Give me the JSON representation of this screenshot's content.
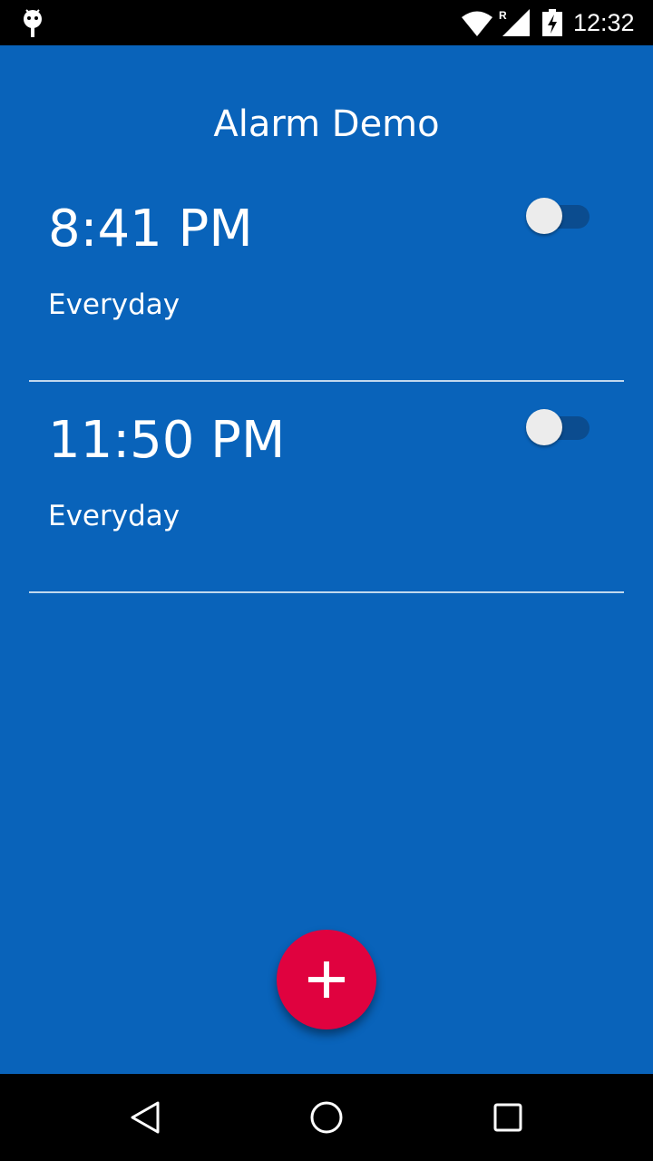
{
  "status_bar": {
    "time": "12:32",
    "icons": [
      "android-debug-icon",
      "wifi-icon",
      "cell-signal-icon",
      "battery-charging-icon"
    ],
    "roaming_indicator": "R"
  },
  "app": {
    "title": "Alarm Demo"
  },
  "alarms": [
    {
      "time": "8:41 PM",
      "repeat": "Everyday",
      "enabled": false
    },
    {
      "time": "11:50 PM",
      "repeat": "Everyday",
      "enabled": false
    }
  ],
  "fab": {
    "icon": "plus-icon",
    "color": "#E0023F"
  },
  "nav_bar": {
    "icons": [
      "back-icon",
      "home-icon",
      "recents-icon"
    ]
  },
  "colors": {
    "background": "#0963BA",
    "toggle_track": "#0B4C8F",
    "toggle_thumb": "#ECECEC"
  }
}
